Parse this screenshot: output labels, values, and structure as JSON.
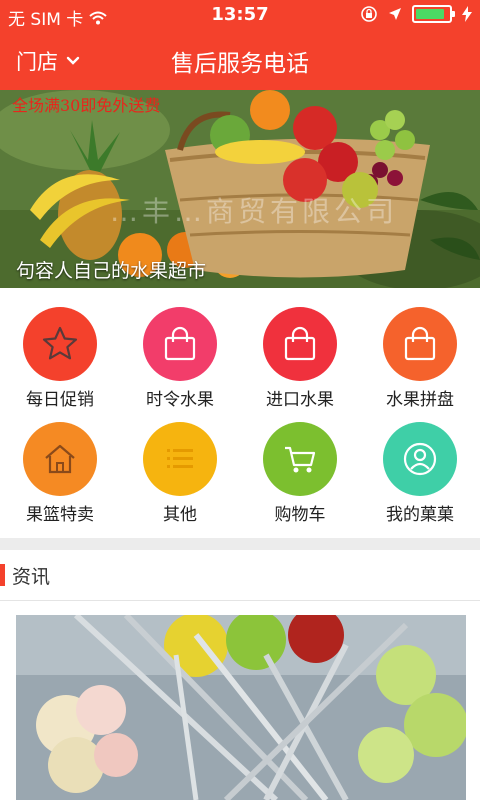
{
  "status_bar": {
    "carrier": "无 SIM 卡",
    "time": "13:57"
  },
  "nav": {
    "store_label": "门店",
    "title": "售后服务电话"
  },
  "banner": {
    "promo_text": "全场满30即免外送费",
    "caption": "句容人自己的水果超市",
    "watermark": "…丰…商贸有限公司"
  },
  "categories": [
    {
      "label": "每日促销",
      "icon": "star-icon",
      "color": "#f4412c"
    },
    {
      "label": "时令水果",
      "icon": "shopping-bag-icon",
      "color": "#f23d6a"
    },
    {
      "label": "进口水果",
      "icon": "shopping-bag-icon",
      "color": "#f0313d"
    },
    {
      "label": "水果拼盘",
      "icon": "shopping-bag-icon",
      "color": "#f5622c"
    },
    {
      "label": "果篮特卖",
      "icon": "home-icon",
      "color": "#f58a23"
    },
    {
      "label": "其他",
      "icon": "list-icon",
      "color": "#f6b40f"
    },
    {
      "label": "购物车",
      "icon": "cart-icon",
      "color": "#7cbf2f"
    },
    {
      "label": "我的菓菓",
      "icon": "user-icon",
      "color": "#3fcfa7"
    }
  ],
  "news": {
    "section_title": "资讯"
  }
}
